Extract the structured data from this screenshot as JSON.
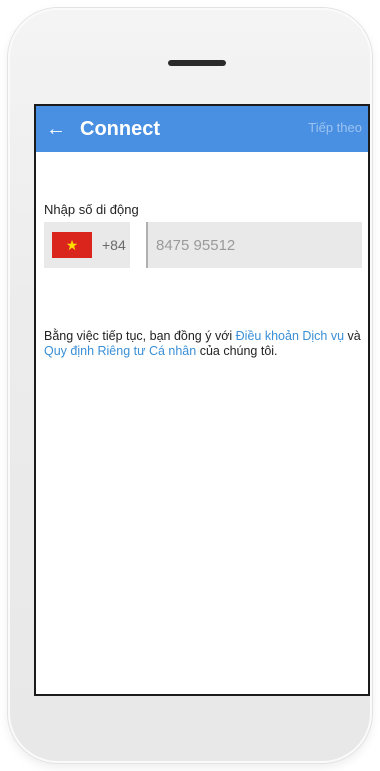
{
  "appbar": {
    "back_icon": "arrow-left-icon",
    "title": "Connect",
    "next_label": "Tiếp theo"
  },
  "form": {
    "label": "Nhập số di động",
    "country_flag": "vietnam-flag-icon",
    "country_code": "+84",
    "phone_value": "8475 95512"
  },
  "terms": {
    "prefix": "Bằng việc tiếp tục, bạn đồng ý với ",
    "link1": "Điều khoản Dịch vụ",
    "middle": " và ",
    "link2": "Quy định Riêng tư Cá nhân",
    "suffix": " của chúng tôi."
  },
  "colors": {
    "appbar": "#4a90e2",
    "link": "#3a8fd6",
    "flag_red": "#da251d",
    "flag_star": "#ffde00"
  }
}
